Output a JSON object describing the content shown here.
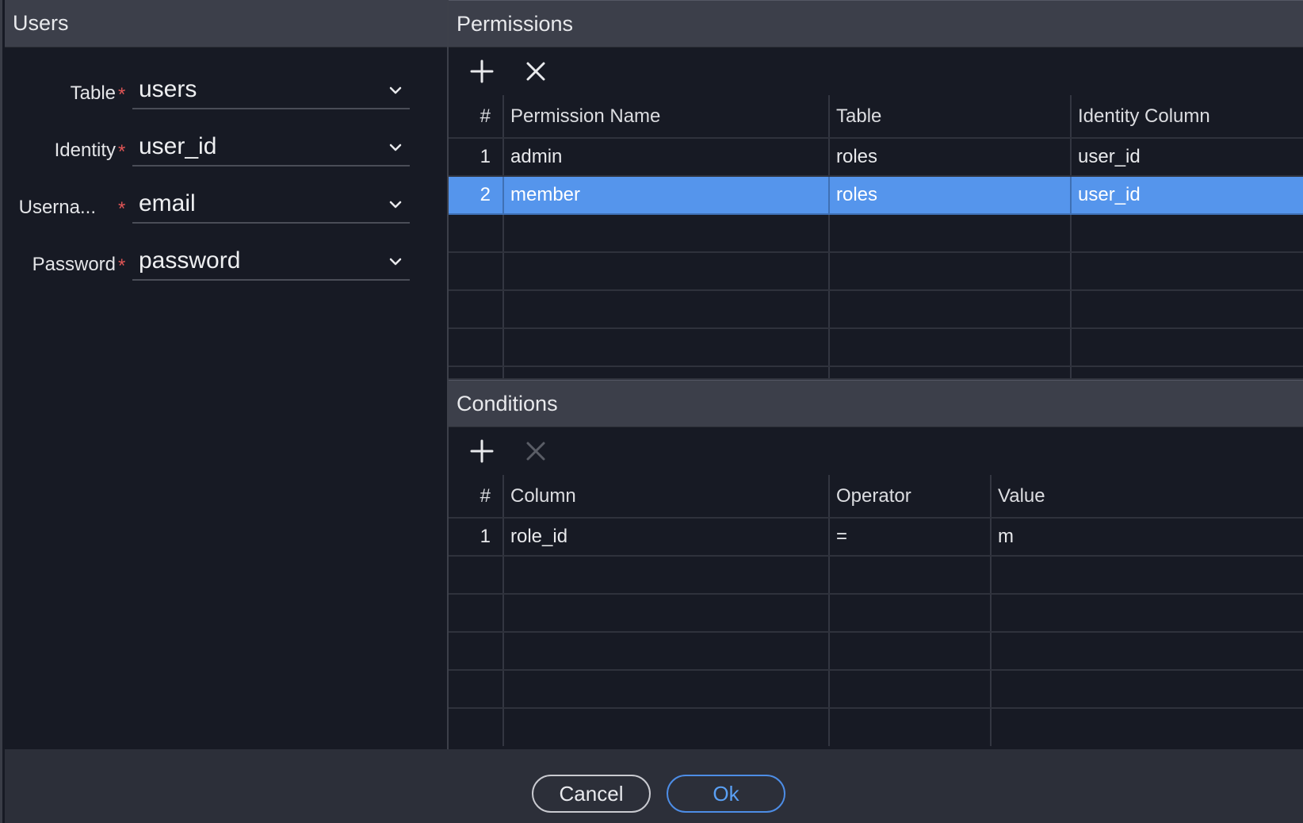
{
  "users_panel": {
    "title": "Users",
    "fields": [
      {
        "label": "Table",
        "value": "users"
      },
      {
        "label": "Identity",
        "value": "user_id"
      },
      {
        "label": "Userna...",
        "value": "email"
      },
      {
        "label": "Password",
        "value": "password"
      }
    ],
    "required_marker": "*"
  },
  "permissions_panel": {
    "title": "Permissions",
    "columns": [
      "#",
      "Permission Name",
      "Table",
      "Identity Column"
    ],
    "rows": [
      {
        "num": "1",
        "name": "admin",
        "table": "roles",
        "identity": "user_id"
      },
      {
        "num": "2",
        "name": "member",
        "table": "roles",
        "identity": "user_id",
        "selected": true
      }
    ]
  },
  "conditions_panel": {
    "title": "Conditions",
    "columns": [
      "#",
      "Column",
      "Operator",
      "Value"
    ],
    "rows": [
      {
        "num": "1",
        "column": "role_id",
        "operator": "=",
        "value": "m"
      }
    ]
  },
  "footer": {
    "cancel_label": "Cancel",
    "ok_label": "Ok"
  },
  "icons": {
    "add": "plus-icon",
    "remove": "close-icon",
    "dropdown": "chevron-down-icon"
  },
  "colors": {
    "selection": "#5595ec",
    "required": "#e05555",
    "ok_accent": "#5aa0f5"
  }
}
